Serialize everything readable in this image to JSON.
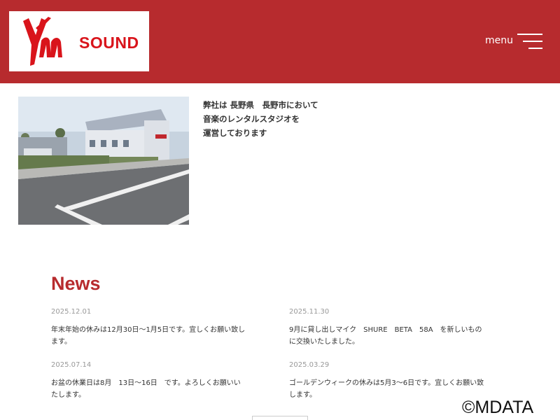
{
  "header": {
    "logo_text": "SOUND",
    "menu_label": "menu",
    "brand_color": "#b72b2e"
  },
  "intro": {
    "lines": [
      "弊社は 長野県　長野市において",
      "音楽のレンタルスタジオを",
      "運営しております"
    ]
  },
  "news": {
    "title": "News",
    "items": [
      {
        "date": "2025.12.01",
        "text": "年末年始の休みは12月30日〜1月5日です。宜しくお願い致します。"
      },
      {
        "date": "2025.11.30",
        "text": "9月に貸し出しマイク　SHURE　BETA　58A　を新しいものに交換いたしました。"
      },
      {
        "date": "2025.07.14",
        "text": "お盆の休業日は8月　13日〜16日　です。よろしくお願いいたします。"
      },
      {
        "date": "2025.03.29",
        "text": "ゴールデンウィークの休みは5月3〜6日です。宜しくお願い致します。"
      }
    ]
  },
  "watermark": "©MDATA"
}
